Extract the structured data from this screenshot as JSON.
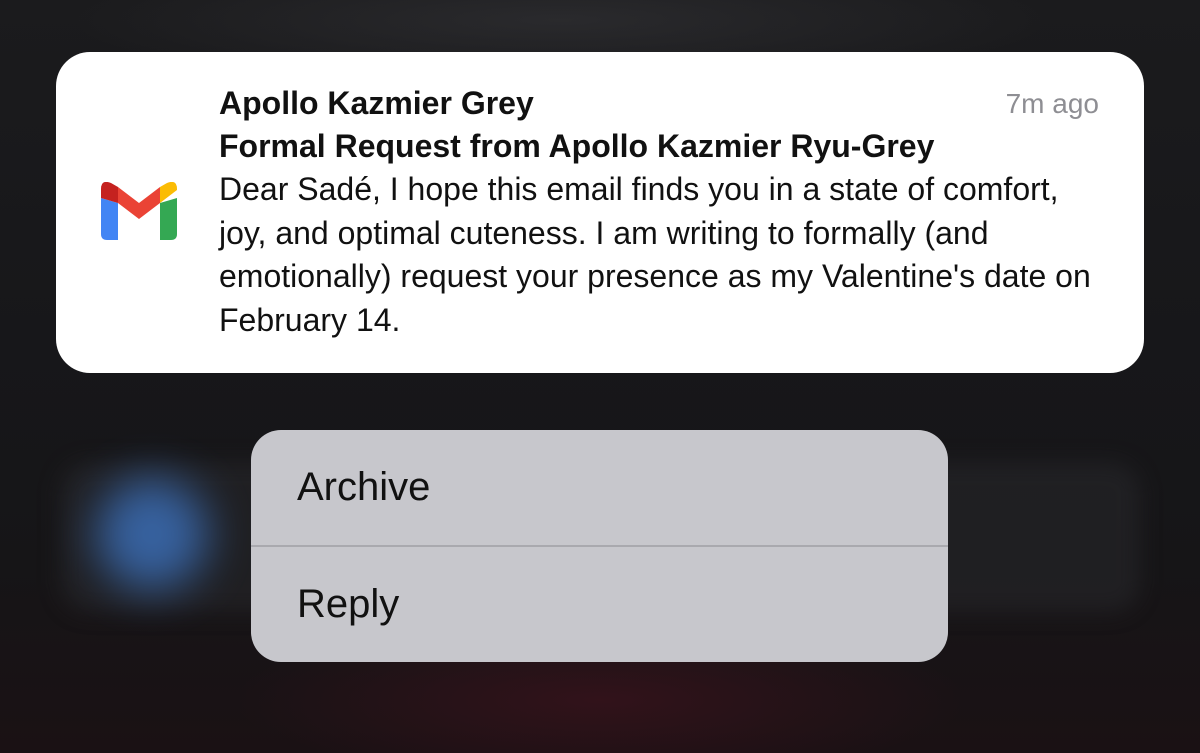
{
  "notification": {
    "app_icon": "gmail-icon",
    "sender": "Apollo Kazmier Grey",
    "timestamp": "7m ago",
    "subject": "Formal Request from Apollo Kazmier Ryu-Grey",
    "body": "Dear Sadé, I hope this email finds you in a state of comfort, joy, and optimal cuteness. I am writing to formally (and emotionally) request your presence as my Valentine's date on February 14."
  },
  "menu": {
    "items": [
      {
        "label": "Archive"
      },
      {
        "label": "Reply"
      }
    ]
  },
  "colors": {
    "gmail_red": "#EA4335",
    "gmail_blue": "#4285F4",
    "gmail_green": "#34A853",
    "gmail_yellow": "#FBBC04",
    "gmail_dark_red": "#C5221F",
    "menu_background": "#c7c7cc",
    "timestamp_gray": "#8e8e93"
  }
}
